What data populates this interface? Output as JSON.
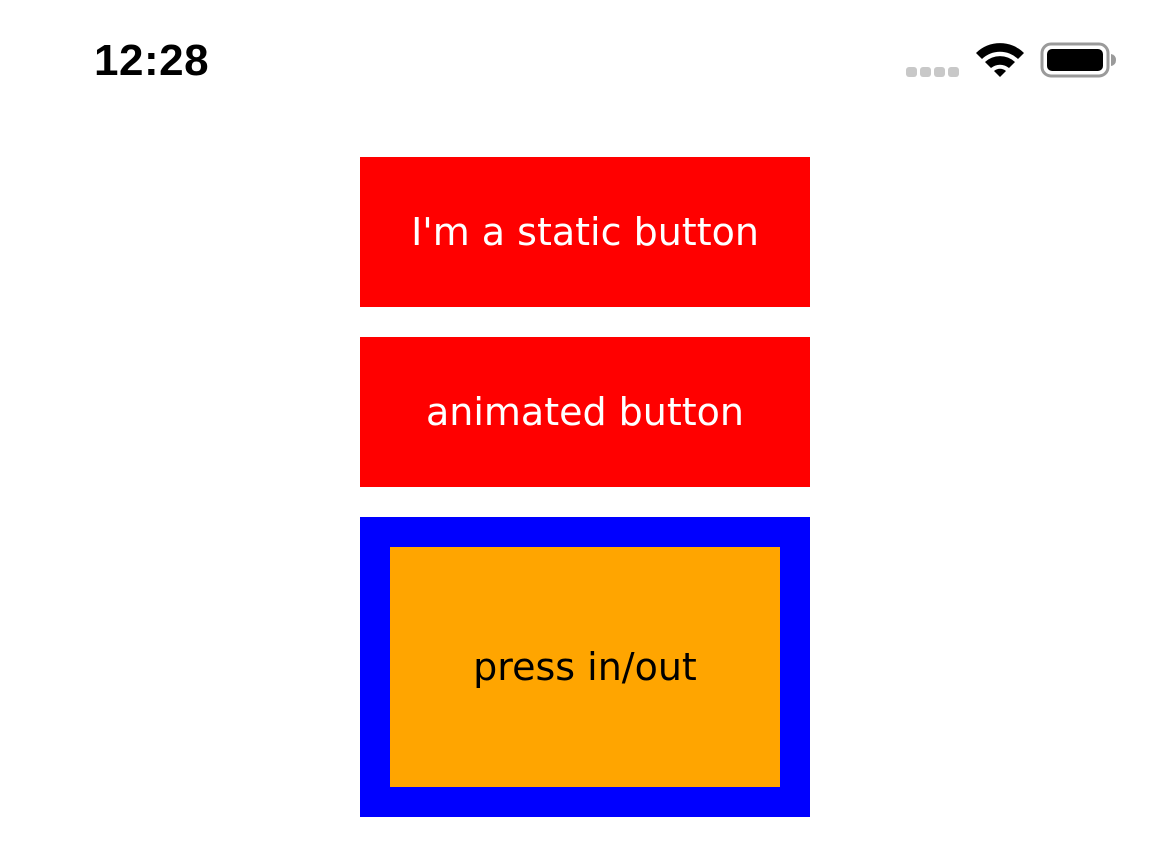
{
  "status_bar": {
    "time": "12:28",
    "icons": [
      "cellular-signal-icon",
      "wifi-icon",
      "battery-icon"
    ]
  },
  "buttons": {
    "static": {
      "label": "I'm a static button",
      "background": "#ff0000",
      "text_color": "#ffffff"
    },
    "animated": {
      "label": "animated button",
      "background": "#ff0000",
      "text_color": "#ffffff"
    },
    "press": {
      "label": "press in/out",
      "background": "#ffa500",
      "frame_color": "#0000ff",
      "text_color": "#000000"
    }
  }
}
